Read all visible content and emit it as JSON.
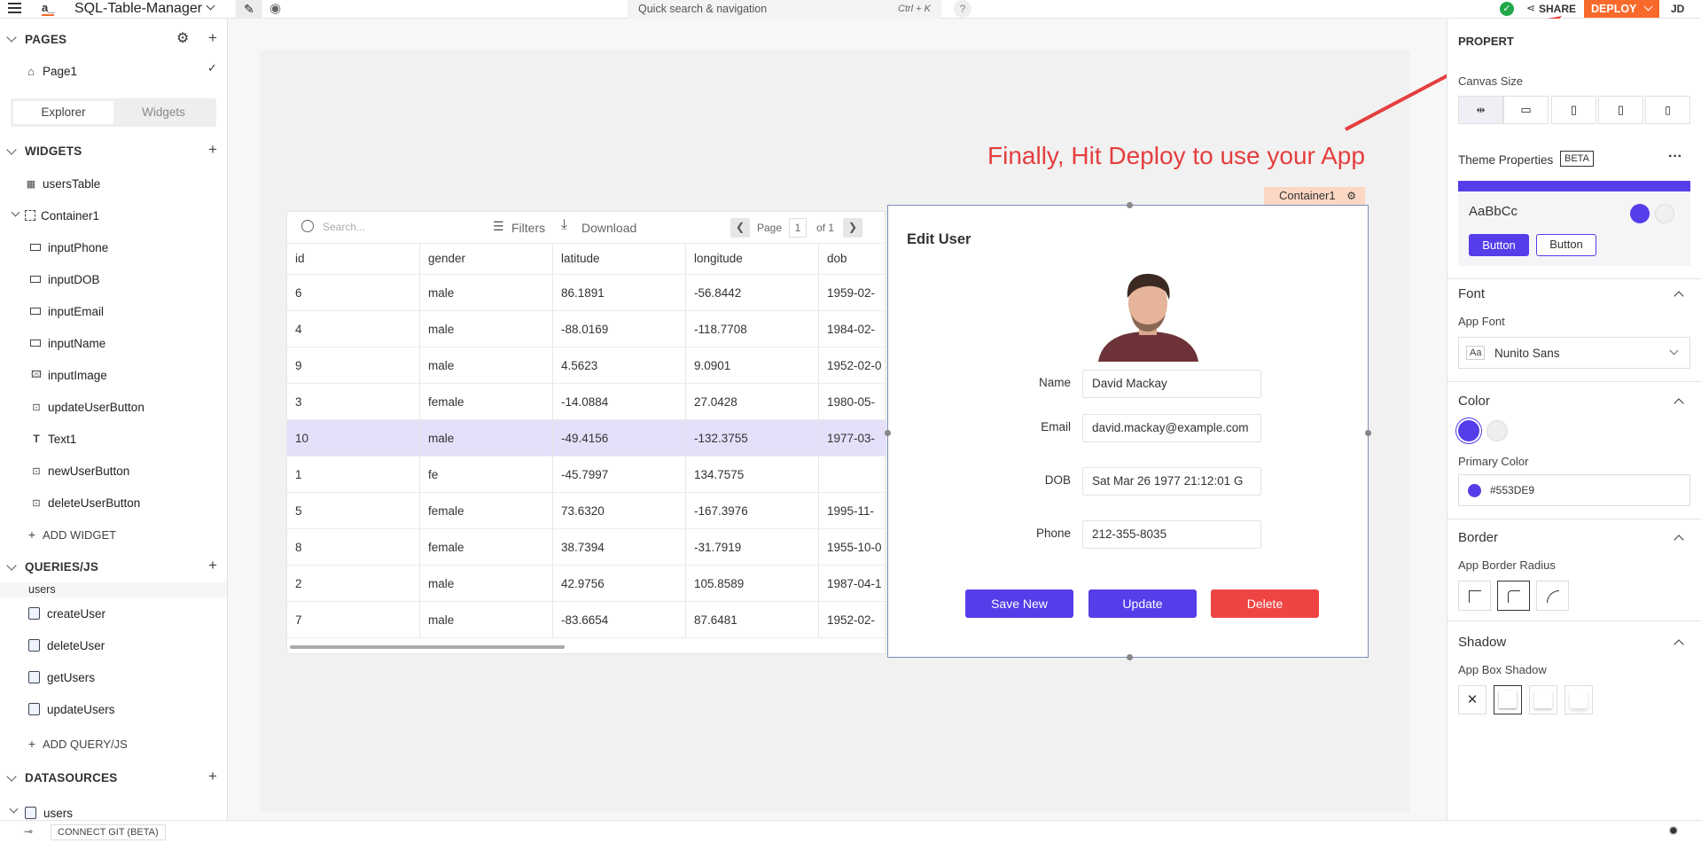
{
  "app": {
    "logo": "a_",
    "title": "SQL-Table-Manager"
  },
  "topbar": {
    "search_label": "Quick search & navigation",
    "search_shortcut": "Ctrl + K",
    "help": "?",
    "share_label": "SHARE",
    "deploy_label": "DEPLOY",
    "user_initials": "JD"
  },
  "sidebar": {
    "pages_title": "PAGES",
    "pages": [
      "Page1"
    ],
    "tabs": [
      "Explorer",
      "Widgets"
    ],
    "widgets_title": "WIDGETS",
    "widgets": [
      "usersTable",
      "Container1",
      "inputPhone",
      "inputDOB",
      "inputEmail",
      "inputName",
      "inputImage",
      "updateUserButton",
      "Text1",
      "newUserButton",
      "deleteUserButton"
    ],
    "add_widget": "ADD WIDGET",
    "queries_title": "QUERIES/JS",
    "query_group": "users",
    "queries": [
      "createUser",
      "deleteUser",
      "getUsers",
      "updateUsers"
    ],
    "add_query": "ADD QUERY/JS",
    "datasources_title": "DATASOURCES",
    "datasources": [
      "users"
    ]
  },
  "canvas": {
    "annotation": "Finally, Hit Deploy to use your App",
    "container_label": "Container1"
  },
  "table": {
    "search_placeholder": "Search...",
    "filters_label": "Filters",
    "download_label": "Download",
    "page_label": "Page",
    "page_value": "1",
    "page_of": "of 1",
    "columns": [
      "id",
      "gender",
      "latitude",
      "longitude",
      "dob"
    ],
    "rows": [
      [
        "6",
        "male",
        "86.1891",
        "-56.8442",
        "1959-02-"
      ],
      [
        "4",
        "male",
        "-88.0169",
        "-118.7708",
        "1984-02-"
      ],
      [
        "9",
        "male",
        "4.5623",
        "9.0901",
        "1952-02-0"
      ],
      [
        "3",
        "female",
        "-14.0884",
        "27.0428",
        "1980-05-"
      ],
      [
        "10",
        "male",
        "-49.4156",
        "-132.3755",
        "1977-03-"
      ],
      [
        "1",
        "fe",
        "-45.7997",
        "134.7575",
        ""
      ],
      [
        "5",
        "female",
        "73.6320",
        "-167.3976",
        "1995-11-"
      ],
      [
        "8",
        "female",
        "38.7394",
        "-31.7919",
        "1955-10-0"
      ],
      [
        "2",
        "male",
        "42.9756",
        "105.8589",
        "1987-04-1"
      ],
      [
        "7",
        "male",
        "-83.6654",
        "87.6481",
        "1952-02-"
      ]
    ],
    "selected_row": 4
  },
  "form": {
    "title": "Edit User",
    "fields": [
      {
        "label": "Name",
        "value": "David Mackay"
      },
      {
        "label": "Email",
        "value": "david.mackay@example.com"
      },
      {
        "label": "DOB",
        "value": "Sat Mar 26 1977 21:12:01 G"
      },
      {
        "label": "Phone",
        "value": "212-355-8035"
      }
    ],
    "buttons": {
      "save_new": "Save New",
      "update": "Update",
      "delete": "Delete"
    }
  },
  "properties": {
    "title": "PROPERT",
    "canvas_size": "Canvas Size",
    "theme_properties": "Theme Properties",
    "beta": "BETA",
    "theme_sample": "AaBbCc",
    "button_label": "Button",
    "font_title": "Font",
    "app_font_label": "App Font",
    "app_font_icon": "Aa",
    "app_font_value": "Nunito Sans",
    "color_title": "Color",
    "primary_color_label": "Primary Color",
    "primary_color_value": "#553DE9",
    "border_title": "Border",
    "border_radius_label": "App Border Radius",
    "shadow_title": "Shadow",
    "box_shadow_label": "App Box Shadow"
  },
  "bottombar": {
    "connect_git": "CONNECT GIT (BETA)"
  },
  "colors": {
    "primary": "#553DE9",
    "danger": "#EF4444",
    "deploy": "#F86A2B",
    "annotation": "#E53E3E"
  }
}
